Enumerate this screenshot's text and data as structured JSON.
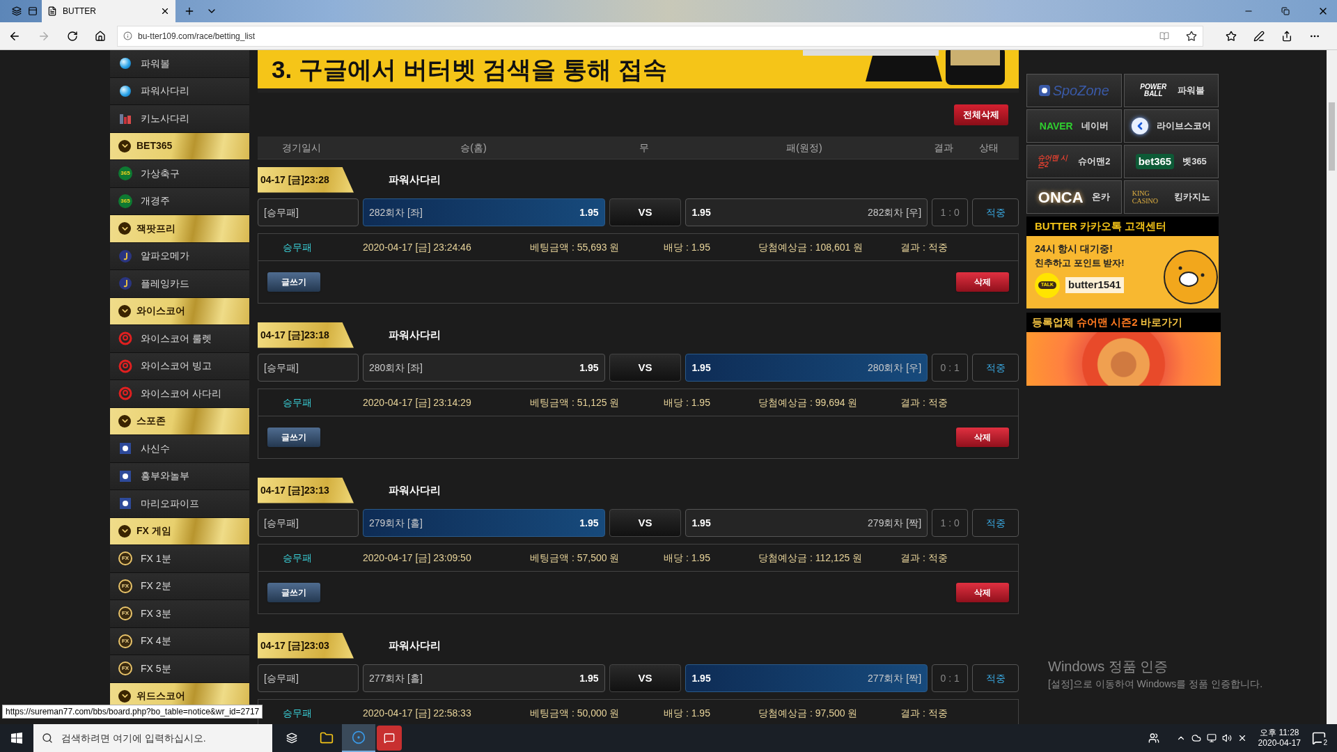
{
  "browser": {
    "tab_title": "BUTTER",
    "url": "bu-tter109.com/race/betting_list"
  },
  "sidebar": {
    "items": [
      {
        "kind": "ball",
        "label": "파워볼"
      },
      {
        "kind": "ball",
        "label": "파워사다리"
      },
      {
        "kind": "building",
        "label": "키노사다리"
      },
      {
        "kind": "group",
        "label": "BET365"
      },
      {
        "kind": "green",
        "badge": "365",
        "label": "가상축구"
      },
      {
        "kind": "green",
        "badge": "365",
        "label": "개경주"
      },
      {
        "kind": "group",
        "label": "잭팟프리"
      },
      {
        "kind": "navy",
        "label": "알파오메가"
      },
      {
        "kind": "navy",
        "label": "플레잉카드"
      },
      {
        "kind": "group",
        "label": "와이스코어"
      },
      {
        "kind": "spiral",
        "label": "와이스코어 룰렛"
      },
      {
        "kind": "spiral",
        "label": "와이스코어 빙고"
      },
      {
        "kind": "spiral",
        "label": "와이스코어 사다리"
      },
      {
        "kind": "group",
        "label": "스포존"
      },
      {
        "kind": "square",
        "label": "사신수"
      },
      {
        "kind": "square",
        "label": "흥부와놀부"
      },
      {
        "kind": "square",
        "label": "마리오파이프"
      },
      {
        "kind": "group",
        "label": "FX 게임"
      },
      {
        "kind": "gold",
        "badge": "FX",
        "label": "FX 1분"
      },
      {
        "kind": "gold",
        "badge": "FX",
        "label": "FX 2분"
      },
      {
        "kind": "gold",
        "badge": "FX",
        "label": "FX 3분"
      },
      {
        "kind": "gold",
        "badge": "FX",
        "label": "FX 4분"
      },
      {
        "kind": "gold",
        "badge": "FX",
        "label": "FX 5분"
      },
      {
        "kind": "group",
        "label": "위드스코어"
      }
    ]
  },
  "banner": {
    "text": "3. 구글에서 버터벳 검색을 통해 접속"
  },
  "delete_all_button": "전체삭제",
  "table": {
    "columns": [
      "경기일시",
      "승(홈)",
      "무",
      "패(원정)",
      "결과",
      "상태"
    ]
  },
  "bets": [
    {
      "time": "04-17 [금]23:28",
      "game": "파워사다리",
      "type": "[승무패]",
      "home": {
        "label": "282회차 [좌]",
        "odds": "1.95",
        "selected": true
      },
      "vs": "VS",
      "away": {
        "odds": "1.95",
        "label": "282회차 [우]",
        "selected": false
      },
      "score": "1 : 0",
      "status": "적중",
      "detail": {
        "type": "승무패",
        "datetime": "2020-04-17 [금] 23:24:46",
        "amount": "베팅금액 : 55,693 원",
        "odds": "배당 : 1.95",
        "payout": "당첨예상금 : 108,601 원",
        "result": "결과 : 적중"
      },
      "buttons": {
        "write": "글쓰기",
        "delete": "삭제"
      }
    },
    {
      "time": "04-17 [금]23:18",
      "game": "파워사다리",
      "type": "[승무패]",
      "home": {
        "label": "280회차 [좌]",
        "odds": "1.95",
        "selected": false
      },
      "vs": "VS",
      "away": {
        "odds": "1.95",
        "label": "280회차 [우]",
        "selected": true
      },
      "score": "0 : 1",
      "status": "적중",
      "detail": {
        "type": "승무패",
        "datetime": "2020-04-17 [금] 23:14:29",
        "amount": "베팅금액 : 51,125 원",
        "odds": "배당 : 1.95",
        "payout": "당첨예상금 : 99,694 원",
        "result": "결과 : 적중"
      },
      "buttons": {
        "write": "글쓰기",
        "delete": "삭제"
      }
    },
    {
      "time": "04-17 [금]23:13",
      "game": "파워사다리",
      "type": "[승무패]",
      "home": {
        "label": "279회차 [홀]",
        "odds": "1.95",
        "selected": true
      },
      "vs": "VS",
      "away": {
        "odds": "1.95",
        "label": "279회차 [짝]",
        "selected": false
      },
      "score": "1 : 0",
      "status": "적중",
      "detail": {
        "type": "승무패",
        "datetime": "2020-04-17 [금] 23:09:50",
        "amount": "베팅금액 : 57,500 원",
        "odds": "배당 : 1.95",
        "payout": "당첨예상금 : 112,125 원",
        "result": "결과 : 적중"
      },
      "buttons": {
        "write": "글쓰기",
        "delete": "삭제"
      }
    },
    {
      "time": "04-17 [금]23:03",
      "game": "파워사다리",
      "type": "[승무패]",
      "home": {
        "label": "277회차 [홀]",
        "odds": "1.95",
        "selected": false
      },
      "vs": "VS",
      "away": {
        "odds": "1.95",
        "label": "277회차 [짝]",
        "selected": true
      },
      "score": "0 : 1",
      "status": "적중",
      "detail": {
        "type": "승무패",
        "datetime": "2020-04-17 [금] 22:58:33",
        "amount": "베팅금액 : 50,000 원",
        "odds": "배당 : 1.95",
        "payout": "당첨예상금 : 97,500 원",
        "result": "결과 : 적중"
      }
    }
  ],
  "partner_links": [
    {
      "kind": "spozone",
      "logo": "SpoZone"
    },
    {
      "kind": "powerball",
      "logo": "POWER BALL",
      "label": "파워볼"
    },
    {
      "kind": "naver",
      "logo": "NAVER",
      "label": "네이버"
    },
    {
      "kind": "livescore",
      "label": "라이브스코어"
    },
    {
      "kind": "sureman",
      "logo": "슈어맨 시즌2",
      "label": "슈어맨2"
    },
    {
      "kind": "bet365",
      "logo": "bet365",
      "label": "벳365"
    },
    {
      "kind": "onca",
      "logo": "ONCA",
      "label": "온카"
    },
    {
      "kind": "kingcasino",
      "logo": "KING CASINO",
      "label": "킹카지노"
    }
  ],
  "kakao_banner": {
    "title": "BUTTER 카카오톡 고객센터",
    "lines": [
      "24시 항시 대기중!",
      "친추하고 포인트 받자!"
    ],
    "talk_badge": "TALK",
    "id": "butter1541"
  },
  "sureman_banner": {
    "parts": [
      {
        "text": "등록업체",
        "highlight": false
      },
      {
        "text": "슈어맨 시즌2",
        "highlight": true
      },
      {
        "text": "바로가기",
        "highlight": false
      }
    ]
  },
  "windows_notice": {
    "title": "Windows 정품 인증",
    "text": "[설정]으로 이동하여 Windows를 정품 인증합니다."
  },
  "status_url": "https://sureman77.com/bbs/board.php?bo_table=notice&wr_id=2717",
  "taskbar": {
    "search_placeholder": "검색하려면 여기에 입력하십시오.",
    "time": "오후 11:28",
    "date": "2020-04-17",
    "notifications": "2"
  }
}
